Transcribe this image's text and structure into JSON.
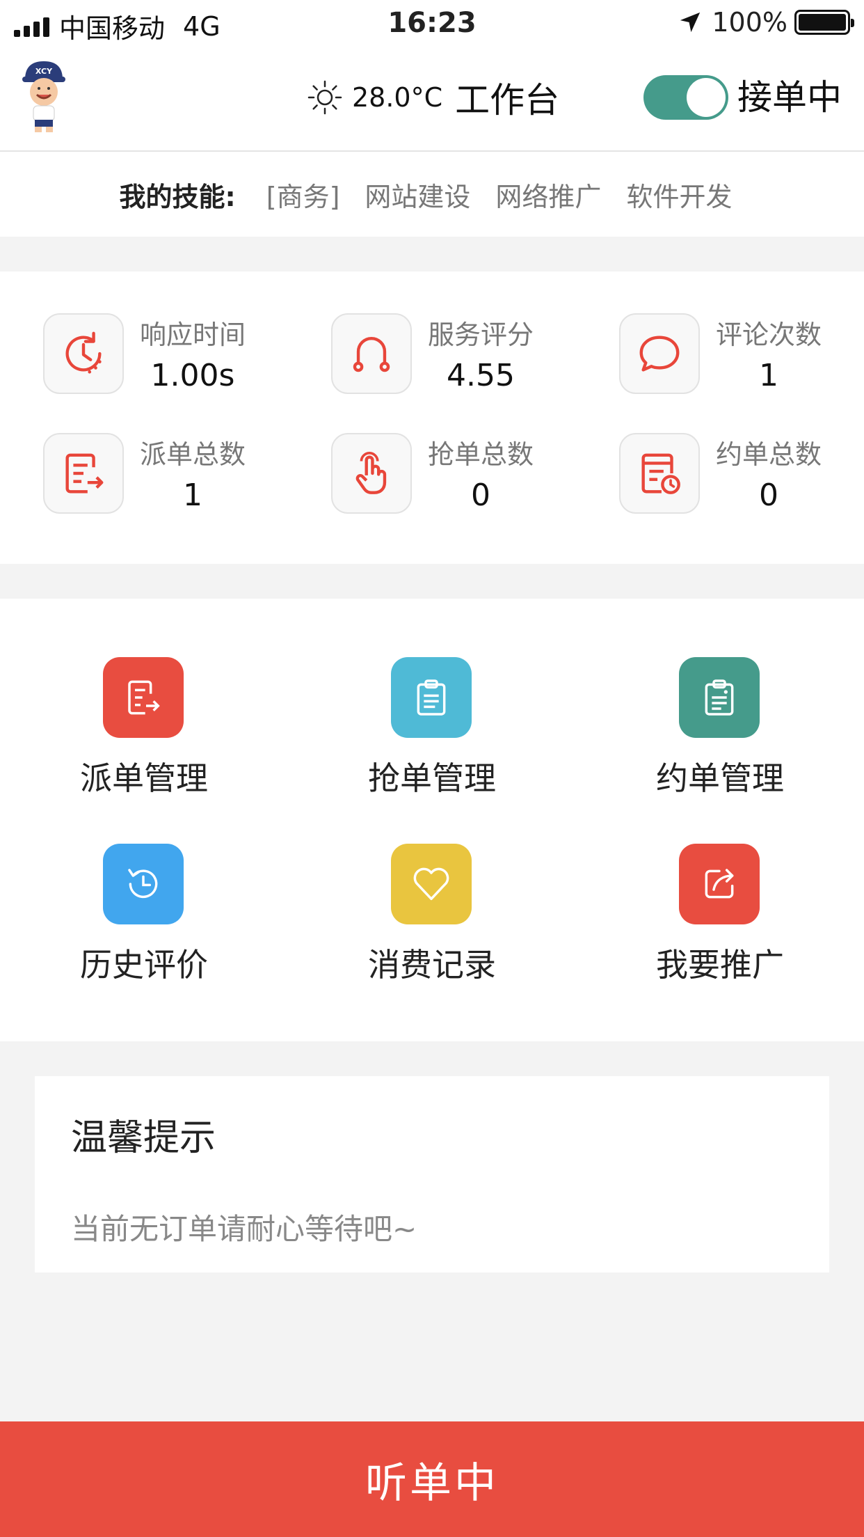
{
  "status_bar": {
    "carrier": "中国移动",
    "network": "4G",
    "time": "16:23",
    "battery": "100%"
  },
  "nav": {
    "temperature": "28.0°C",
    "title": "工作台",
    "toggle_label": "接单中",
    "toggle_on": true,
    "avatar_text": "XCY"
  },
  "skills": {
    "label": "我的技能:",
    "tags": [
      "[商务]",
      "网站建设",
      "网络推广",
      "软件开发"
    ]
  },
  "stats": [
    {
      "label": "响应时间",
      "value": "1.00s",
      "icon": "clock-refresh-icon"
    },
    {
      "label": "服务评分",
      "value": "4.55",
      "icon": "headset-icon"
    },
    {
      "label": "评论次数",
      "value": "1",
      "icon": "chat-bubble-icon"
    },
    {
      "label": "派单总数",
      "value": "1",
      "icon": "dispatch-doc-icon"
    },
    {
      "label": "抢单总数",
      "value": "0",
      "icon": "tap-hand-icon"
    },
    {
      "label": "约单总数",
      "value": "0",
      "icon": "appointment-doc-icon"
    }
  ],
  "menu": [
    {
      "label": "派单管理",
      "color": "#e84d40",
      "icon": "dispatch-icon"
    },
    {
      "label": "抢单管理",
      "color": "#4fbad6",
      "icon": "clipboard-icon"
    },
    {
      "label": "约单管理",
      "color": "#459b8b",
      "icon": "booking-icon"
    },
    {
      "label": "历史评价",
      "color": "#41a6ee",
      "icon": "history-icon"
    },
    {
      "label": "消费记录",
      "color": "#e9c53f",
      "icon": "heart-tag-icon"
    },
    {
      "label": "我要推广",
      "color": "#e84d40",
      "icon": "share-icon"
    }
  ],
  "tips": {
    "title": "温馨提示",
    "content": "当前无订单请耐心等待吧~"
  },
  "bottom_button": {
    "label": "听单中"
  },
  "colors": {
    "accent_red": "#e84d40",
    "teal": "#459b8b",
    "icon_red": "#e8463a"
  }
}
